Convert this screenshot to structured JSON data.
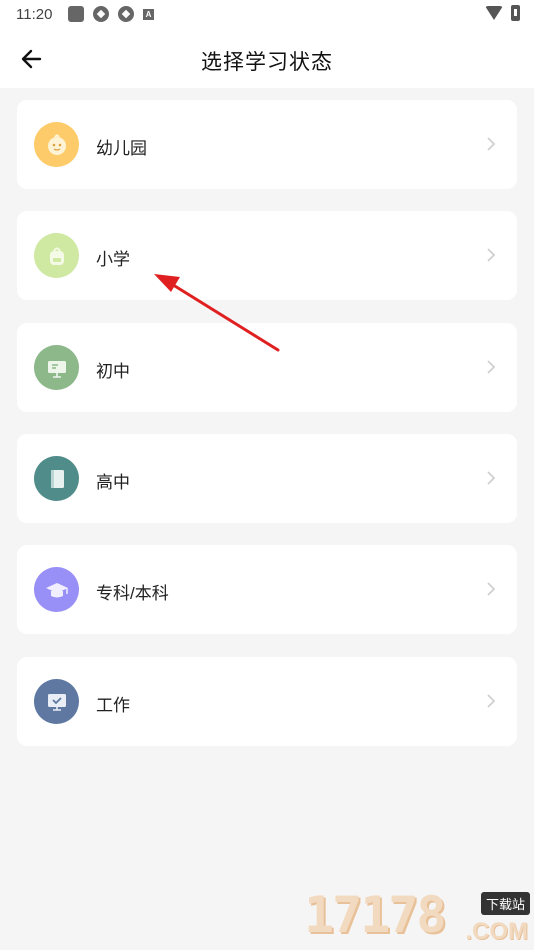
{
  "status_bar": {
    "time": "11:20",
    "left_icons": [
      "square-icon",
      "aperture-icon",
      "aperture-icon",
      "a-icon"
    ],
    "right_icons": [
      "wifi-icon",
      "battery-icon"
    ]
  },
  "header": {
    "title": "选择学习状态",
    "back_icon": "arrow-left-icon"
  },
  "options": [
    {
      "label": "幼儿园",
      "icon": "baby-face-icon",
      "color": "#fecb6a"
    },
    {
      "label": "小学",
      "icon": "backpack-icon",
      "color": "#cfe8a2"
    },
    {
      "label": "初中",
      "icon": "board-icon",
      "color": "#8cb88a"
    },
    {
      "label": "高中",
      "icon": "book-icon",
      "color": "#4f8c8a"
    },
    {
      "label": "专科/本科",
      "icon": "graduation-cap-icon",
      "color": "#9890f6"
    },
    {
      "label": "工作",
      "icon": "monitor-check-icon",
      "color": "#5e78a2"
    }
  ],
  "annotation": {
    "arrow_color": "#e02020"
  },
  "watermark": {
    "digits": "17178",
    "badge": "下载站",
    "suffix": ".COM"
  }
}
